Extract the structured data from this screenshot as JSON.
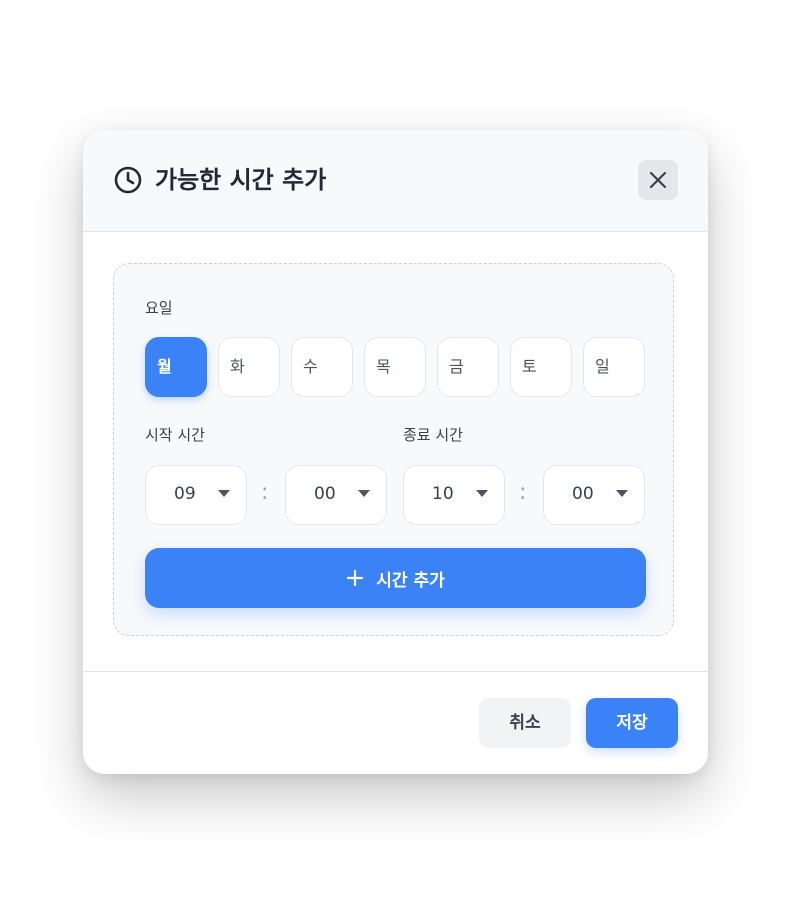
{
  "dialog": {
    "title": "가능한 시간 추가",
    "title_icon": "clock-icon",
    "close_icon": "close-icon"
  },
  "form": {
    "day_label": "요일",
    "days": [
      {
        "label": "월",
        "selected": true
      },
      {
        "label": "화",
        "selected": false
      },
      {
        "label": "수",
        "selected": false
      },
      {
        "label": "목",
        "selected": false
      },
      {
        "label": "금",
        "selected": false
      },
      {
        "label": "토",
        "selected": false
      },
      {
        "label": "일",
        "selected": false
      }
    ],
    "start_label": "시작 시간",
    "end_label": "종료 시간",
    "start_hour": "09",
    "start_minute": "00",
    "end_hour": "10",
    "end_minute": "00",
    "separator": ":",
    "add_button_label": "시간 추가",
    "add_button_icon": "plus-icon"
  },
  "footer": {
    "cancel_label": "취소",
    "save_label": "저장"
  },
  "colors": {
    "accent": "#3b82f6",
    "header_bg": "#f8f9fb",
    "card_border": "#cbd0d8"
  }
}
